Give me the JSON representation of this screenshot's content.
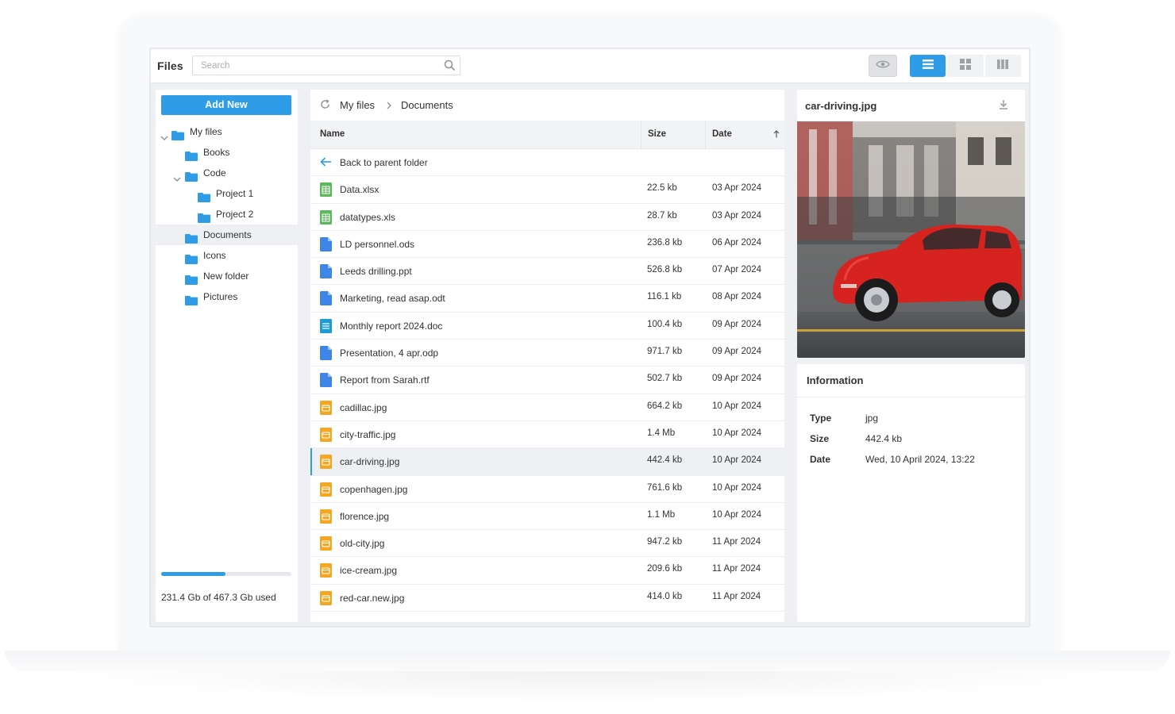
{
  "app": {
    "title": "Files"
  },
  "search": {
    "placeholder": "Search"
  },
  "toolbar": {
    "preview_icon": "eye-icon",
    "views": [
      {
        "name": "list-view",
        "icon": "list-icon",
        "active": true
      },
      {
        "name": "grid-view",
        "icon": "grid-icon",
        "active": false
      },
      {
        "name": "columns-view",
        "icon": "columns-icon",
        "active": false
      }
    ]
  },
  "sidebar": {
    "add_new_label": "Add New",
    "tree": [
      {
        "label": "My files",
        "expanded": true,
        "level": 0
      },
      {
        "label": "Books",
        "level": 1
      },
      {
        "label": "Code",
        "expanded": true,
        "level": 1
      },
      {
        "label": "Project 1",
        "level": 2
      },
      {
        "label": "Project 2",
        "level": 2
      },
      {
        "label": "Documents",
        "level": 1,
        "selected": true
      },
      {
        "label": "Icons",
        "level": 1
      },
      {
        "label": "New folder",
        "level": 1
      },
      {
        "label": "Pictures",
        "level": 1
      }
    ],
    "storage": {
      "used_fraction": 0.495,
      "text": "231.4 Gb of 467.3 Gb used"
    }
  },
  "breadcrumb": {
    "items": [
      "My files",
      "Documents"
    ]
  },
  "table": {
    "headers": {
      "name": "Name",
      "size": "Size",
      "date": "Date"
    },
    "back_label": "Back to parent folder",
    "rows": [
      {
        "name": "Data.xlsx",
        "size": "22.5 kb",
        "date": "03 Apr 2024",
        "type": "sheet"
      },
      {
        "name": "datatypes.xls",
        "size": "28.7 kb",
        "date": "03 Apr 2024",
        "type": "sheet"
      },
      {
        "name": "LD personnel.ods",
        "size": "236.8 kb",
        "date": "06 Apr 2024",
        "type": "doc"
      },
      {
        "name": "Leeds drilling.ppt",
        "size": "526.8 kb",
        "date": "07 Apr 2024",
        "type": "doc"
      },
      {
        "name": "Marketing, read asap.odt",
        "size": "116.1 kb",
        "date": "08 Apr 2024",
        "type": "doc"
      },
      {
        "name": "Monthly report 2024.doc",
        "size": "100.4 kb",
        "date": "09 Apr 2024",
        "type": "text"
      },
      {
        "name": "Presentation, 4 apr.odp",
        "size": "971.7 kb",
        "date": "09 Apr 2024",
        "type": "doc"
      },
      {
        "name": "Report from Sarah.rtf",
        "size": "502.7 kb",
        "date": "09 Apr 2024",
        "type": "doc"
      },
      {
        "name": "cadillac.jpg",
        "size": "664.2 kb",
        "date": "10 Apr 2024",
        "type": "image"
      },
      {
        "name": "city-traffic.jpg",
        "size": "1.4 Mb",
        "date": "10 Apr 2024",
        "type": "image"
      },
      {
        "name": "car-driving.jpg",
        "size": "442.4 kb",
        "date": "10 Apr 2024",
        "type": "image",
        "selected": true
      },
      {
        "name": "copenhagen.jpg",
        "size": "761.6 kb",
        "date": "10 Apr 2024",
        "type": "image"
      },
      {
        "name": "florence.jpg",
        "size": "1.1 Mb",
        "date": "10 Apr 2024",
        "type": "image"
      },
      {
        "name": "old-city.jpg",
        "size": "947.2 kb",
        "date": "11 Apr 2024",
        "type": "image"
      },
      {
        "name": "ice-cream.jpg",
        "size": "209.6 kb",
        "date": "11 Apr 2024",
        "type": "image"
      },
      {
        "name": "red-car.new.jpg",
        "size": "414.0 kb",
        "date": "11 Apr 2024",
        "type": "image"
      }
    ]
  },
  "preview": {
    "title": "car-driving.jpg"
  },
  "info": {
    "title": "Information",
    "rows": [
      {
        "key": "Type",
        "value": "jpg"
      },
      {
        "key": "Size",
        "value": "442.4 kb"
      },
      {
        "key": "Date",
        "value": "Wed, 10 April 2024, 13:22"
      }
    ]
  },
  "colors": {
    "accent": "#2f9ce8",
    "sheet": "#5cb85c",
    "doc": "#3d86e8",
    "text": "#1e9bd7",
    "image": "#f5a623"
  }
}
